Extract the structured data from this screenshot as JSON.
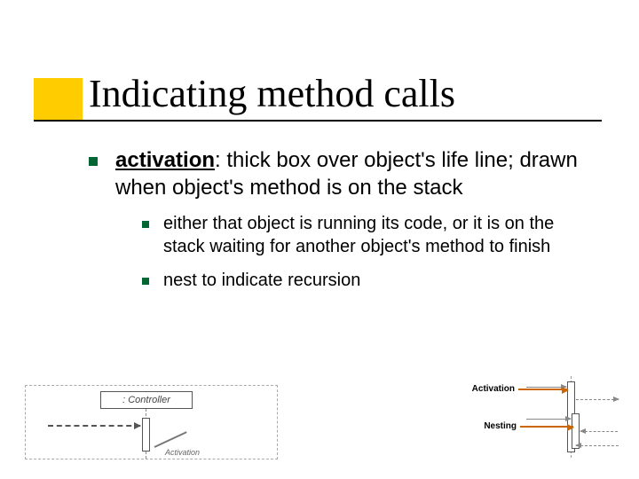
{
  "title": "Indicating method calls",
  "main_bullet": {
    "term": "activation",
    "rest": ": thick box over object's life line; drawn when object's method is on the stack"
  },
  "sub_bullets": [
    "either that object is running its code, or it is on the stack waiting for another object's method to finish",
    "nest to indicate recursion"
  ],
  "diagram_left": {
    "object_label": ": Controller",
    "pointer_label": "Activation"
  },
  "callouts": {
    "activation": "Activation",
    "nesting": "Nesting"
  }
}
